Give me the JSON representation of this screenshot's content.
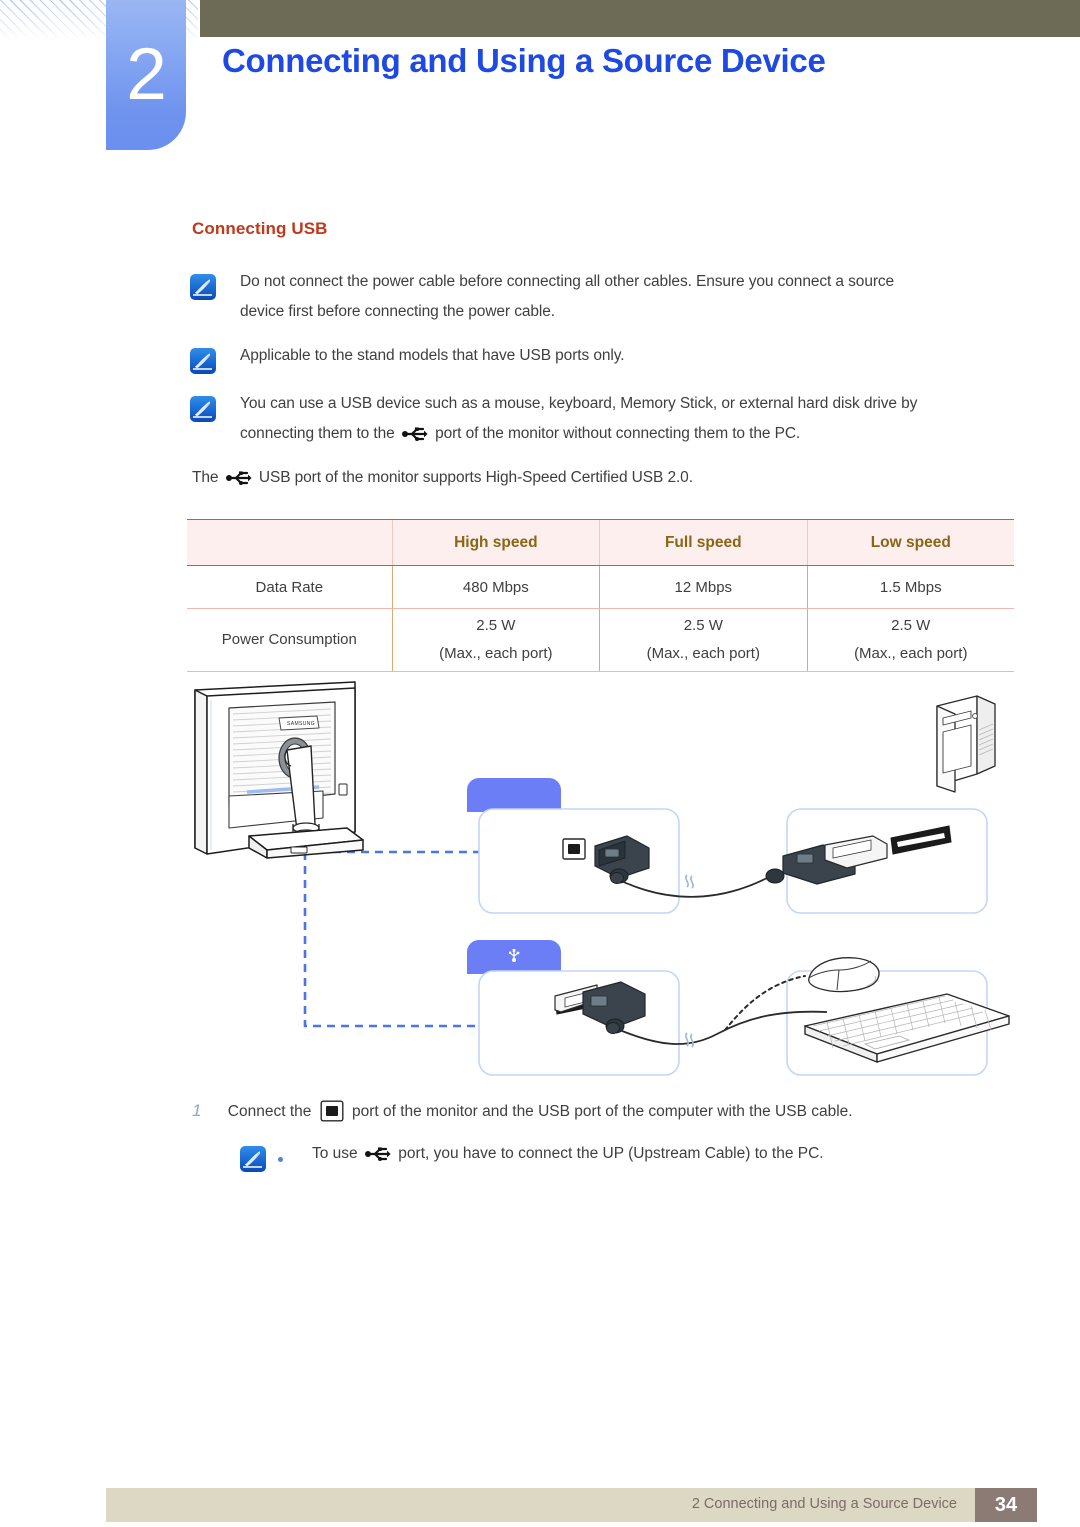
{
  "header": {
    "chapter_number": "2",
    "chapter_title": "Connecting and Using a Source Device",
    "accent_title_color": "#1e49e2",
    "badge_color": "#86a7f2",
    "olive_bar_color": "#6d6b56"
  },
  "section": {
    "heading": "Connecting USB",
    "heading_color": "#c0391a"
  },
  "notes": [
    {
      "icon": "note-pen-icon",
      "line1": "Do not connect the power cable before connecting all other cables. Ensure you connect a source",
      "line2": "device first before connecting the power cable."
    },
    {
      "icon": "note-pen-icon",
      "line1": "Applicable to the stand models that have USB ports only.",
      "line2": ""
    },
    {
      "icon": "note-pen-icon",
      "line1": "You can use a USB device such as a mouse, keyboard, Memory Stick, or external hard disk drive by",
      "line2_before_icon": "connecting them to the",
      "line2_icon": "usb-trident-icon",
      "line2_after_icon": "port of the monitor without connecting them to the PC."
    }
  ],
  "usb_support_line": {
    "before_icon": "The",
    "icon": "usb-trident-icon",
    "after_icon": "USB port of the monitor supports High-Speed Certified USB 2.0."
  },
  "table": {
    "header_text_color": "#8a6516",
    "header_bg_color": "#fcefee",
    "columns": [
      "",
      "High speed",
      "Full speed",
      "Low speed"
    ],
    "rows": [
      {
        "label": "Data Rate",
        "cells": [
          {
            "line1": "480 Mbps",
            "line2": ""
          },
          {
            "line1": "12 Mbps",
            "line2": ""
          },
          {
            "line1": "1.5 Mbps",
            "line2": ""
          }
        ]
      },
      {
        "label": "Power Consumption",
        "cells": [
          {
            "line1": "2.5 W",
            "line2": "(Max., each port)"
          },
          {
            "line1": "2.5 W",
            "line2": "(Max., each port)"
          },
          {
            "line1": "2.5 W",
            "line2": "(Max., each port)"
          }
        ]
      }
    ]
  },
  "diagram": {
    "monitor_brand_label": "SAMSUNG",
    "tab_color": "#6b7ef5",
    "callout_border_color": "#c3d6f7",
    "dashed_line_color": "#4a74e8",
    "callouts": [
      {
        "name": "monitor-upstream-port-callout",
        "tab_icon": ""
      },
      {
        "name": "pc-usb-port-callout",
        "tab_icon": ""
      },
      {
        "name": "monitor-downstream-port-callout",
        "tab_icon": "usb-trident-icon"
      },
      {
        "name": "mouse-keyboard-callout",
        "tab_icon": ""
      }
    ]
  },
  "step": {
    "number": "1",
    "text_before_icon": "Connect the",
    "icon": "usb-type-b-port-icon",
    "text_after_icon": "port of the monitor and the USB port of the computer with the USB cable.",
    "note": {
      "icon": "note-pen-icon",
      "text_before_icon": "To use",
      "inline_icon": "usb-trident-icon",
      "text_after_icon": "port, you have to connect the UP (Upstream Cable) to the PC."
    }
  },
  "footer": {
    "text": "2 Connecting and Using a Source Device",
    "page_number": "34",
    "bar_color": "#dcd8c3",
    "page_box_color": "#8c7b75"
  }
}
